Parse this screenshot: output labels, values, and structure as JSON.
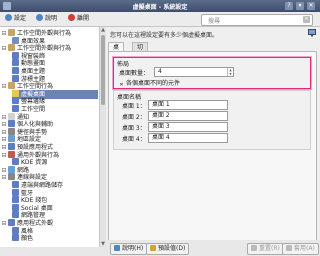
{
  "window": {
    "title": "虛擬桌面 - 系統設定"
  },
  "toolbar": {
    "settings_label": "設定",
    "help_label": "說明",
    "quit_label": "離開",
    "search_placeholder": "搜尋"
  },
  "sidebar": {
    "items": [
      {
        "label": "工作空間外觀與行為",
        "level": 0,
        "icon": "workspace-icon",
        "color": "#c6a56a"
      },
      {
        "label": "桌面效果",
        "level": 1,
        "icon": "effects-icon",
        "color": "#6f8fc9"
      },
      {
        "label": "工作空間外觀與行為",
        "level": 0,
        "icon": "appearance-icon",
        "color": "#c6a56a"
      },
      {
        "label": "視窗裝飾",
        "level": 1,
        "icon": "windows-icon",
        "color": "#5d7fc2"
      },
      {
        "label": "動態畫面",
        "level": 1,
        "icon": "splash-icon",
        "color": "#5d7fc2"
      },
      {
        "label": "桌面主題",
        "level": 1,
        "icon": "theme-icon",
        "color": "#5d7fc2"
      },
      {
        "label": "游標主題",
        "level": 1,
        "icon": "cursor-icon",
        "color": "#5d7fc2"
      },
      {
        "label": "工作空間行為",
        "level": 0,
        "icon": "behavior-icon",
        "color": "#c6a56a"
      },
      {
        "label": "虛擬桌面",
        "level": 1,
        "icon": "virtual-desktop-icon",
        "color": "#e9c84a",
        "selected": true
      },
      {
        "label": "螢幕邊緣",
        "level": 1,
        "icon": "screen-edges-icon",
        "color": "#5d7fc2"
      },
      {
        "label": "工作空間",
        "level": 1,
        "icon": "workspace-icon",
        "color": "#5d7fc2"
      },
      {
        "label": "通知",
        "level": 0,
        "icon": "bell-icon",
        "color": "#d2d2d2"
      },
      {
        "label": "個人化與輔助",
        "level": 0,
        "icon": "accessibility-icon",
        "color": "#5d7fc2"
      },
      {
        "label": "捷徑與手勢",
        "level": 0,
        "icon": "shortcuts-icon",
        "color": "#888888"
      },
      {
        "label": "地區設定",
        "level": 0,
        "icon": "locale-icon",
        "color": "#6a9fd6"
      },
      {
        "label": "預設應用程式",
        "level": 0,
        "icon": "apps-icon",
        "color": "#5d7fc2"
      },
      {
        "label": "通用外觀與行為",
        "level": 0,
        "icon": "general-icon",
        "color": "#c65a4a"
      },
      {
        "label": "KDE 資源",
        "level": 1,
        "icon": "kde-icon",
        "color": "#5d7fc2"
      },
      {
        "label": "網路",
        "level": 0,
        "icon": "network-icon",
        "color": "#6a9fd6"
      },
      {
        "label": "連線與設定",
        "level": 0,
        "icon": "connections-icon",
        "color": "#888888"
      },
      {
        "label": "遠端與網路儲存",
        "level": 1,
        "icon": "remote-icon",
        "color": "#5d7fc2"
      },
      {
        "label": "藍牙",
        "level": 1,
        "icon": "bluetooth-icon",
        "color": "#5d7fc2"
      },
      {
        "label": "KDE 錢包",
        "level": 1,
        "icon": "wallet-icon",
        "color": "#5d7fc2"
      },
      {
        "label": "Social 桌面",
        "level": 1,
        "icon": "social-icon",
        "color": "#5d7fc2"
      },
      {
        "label": "網路管理",
        "level": 1,
        "icon": "network-manager-icon",
        "color": "#5d7fc2"
      },
      {
        "label": "應用程式外觀",
        "level": 0,
        "icon": "app-appearance-icon",
        "color": "#5d7fc2"
      },
      {
        "label": "風格",
        "level": 1,
        "icon": "style-icon",
        "color": "#5d7fc2"
      },
      {
        "label": "顏色",
        "level": 1,
        "icon": "colors-icon",
        "color": "#5d7fc2"
      }
    ]
  },
  "main": {
    "description": "您可以在這裡設定要有多少個虛擬桌面。",
    "tabs": [
      {
        "label": "桌面",
        "active": true
      },
      {
        "label": "切換",
        "active": false
      }
    ],
    "layout_group": {
      "title": "佈局",
      "count_label": "桌面數量：",
      "count_value": "4",
      "different_widgets_label": "各個桌面不同的元件",
      "different_widgets_checked": true
    },
    "names_group": {
      "title": "桌面名稱",
      "rows": [
        {
          "label": "桌面 1：",
          "value": "桌面 1"
        },
        {
          "label": "桌面 2：",
          "value": "桌面 2"
        },
        {
          "label": "桌面 3：",
          "value": "桌面 3"
        },
        {
          "label": "桌面 4：",
          "value": "桌面 4"
        }
      ]
    }
  },
  "footer": {
    "help_label": "說明(H)",
    "defaults_label": "預設值(D)",
    "reset_label": "重置(R)",
    "apply_label": "套用(A)"
  }
}
